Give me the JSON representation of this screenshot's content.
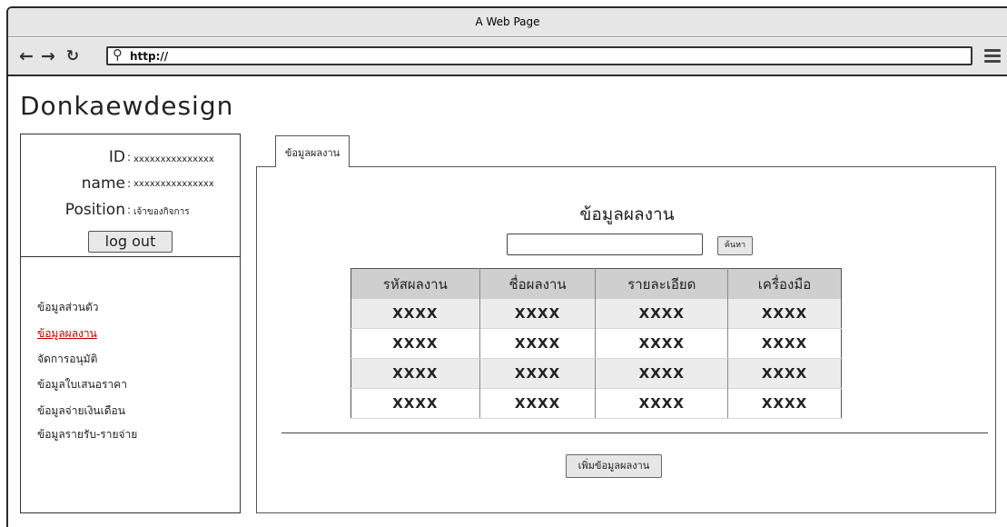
{
  "browser": {
    "title": "A Web Page",
    "url": "http://",
    "icons": {
      "back": "arrow-left-icon",
      "forward": "arrow-right-icon",
      "reload": "reload-icon",
      "search": "search-icon",
      "menu": "hamburger-menu-icon"
    }
  },
  "brand": "Donkaewdesign",
  "profile": {
    "id_label": "ID",
    "id_value": "xxxxxxxxxxxxxxx",
    "name_label": "name",
    "name_value": "xxxxxxxxxxxxxxx",
    "position_label": "Position",
    "position_value": "เจ้าของกิจการ",
    "separator": ":",
    "logout_label": "log out"
  },
  "menu": {
    "items": [
      {
        "label": "ข้อมูลส่วนตัว",
        "active": false
      },
      {
        "label": "ข้อมูลผลงาน",
        "active": true
      },
      {
        "label": "จัดการอนุมัติ",
        "active": false
      },
      {
        "label": "ข้อมูลใบเสนอราคา",
        "active": false
      },
      {
        "label": "ข้อมูลจ่ายเงินเดือน",
        "active": false
      },
      {
        "label": "ข้อมูลรายรับ-รายจ่าย",
        "active": false
      }
    ],
    "active_color": "#c00000"
  },
  "content": {
    "tab_label": "ข้อมูลผลงาน",
    "title": "ข้อมูลผลงาน",
    "search_value": "",
    "search_button": "ค้นหา",
    "table": {
      "headers": [
        "รหัสผลงาน",
        "ชื่อผลงาน",
        "รายละเอียด",
        "เครื่องมือ"
      ],
      "rows": [
        [
          "XXXX",
          "XXXX",
          "XXXX",
          "XXXX"
        ],
        [
          "XXXX",
          "XXXX",
          "XXXX",
          "XXXX"
        ],
        [
          "XXXX",
          "XXXX",
          "XXXX",
          "XXXX"
        ],
        [
          "XXXX",
          "XXXX",
          "XXXX",
          "XXXX"
        ]
      ]
    },
    "add_button": "เพิ่มข้อมูลผลงาน"
  }
}
